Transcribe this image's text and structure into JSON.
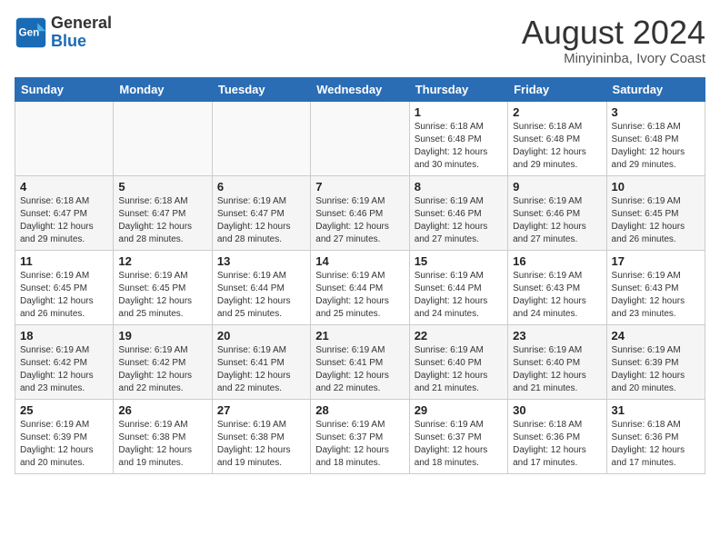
{
  "header": {
    "logo_line1": "General",
    "logo_line2": "Blue",
    "month_year": "August 2024",
    "location": "Minyininba, Ivory Coast"
  },
  "days_of_week": [
    "Sunday",
    "Monday",
    "Tuesday",
    "Wednesday",
    "Thursday",
    "Friday",
    "Saturday"
  ],
  "weeks": [
    [
      {
        "day": "",
        "info": ""
      },
      {
        "day": "",
        "info": ""
      },
      {
        "day": "",
        "info": ""
      },
      {
        "day": "",
        "info": ""
      },
      {
        "day": "1",
        "info": "Sunrise: 6:18 AM\nSunset: 6:48 PM\nDaylight: 12 hours\nand 30 minutes."
      },
      {
        "day": "2",
        "info": "Sunrise: 6:18 AM\nSunset: 6:48 PM\nDaylight: 12 hours\nand 29 minutes."
      },
      {
        "day": "3",
        "info": "Sunrise: 6:18 AM\nSunset: 6:48 PM\nDaylight: 12 hours\nand 29 minutes."
      }
    ],
    [
      {
        "day": "4",
        "info": "Sunrise: 6:18 AM\nSunset: 6:47 PM\nDaylight: 12 hours\nand 29 minutes."
      },
      {
        "day": "5",
        "info": "Sunrise: 6:18 AM\nSunset: 6:47 PM\nDaylight: 12 hours\nand 28 minutes."
      },
      {
        "day": "6",
        "info": "Sunrise: 6:19 AM\nSunset: 6:47 PM\nDaylight: 12 hours\nand 28 minutes."
      },
      {
        "day": "7",
        "info": "Sunrise: 6:19 AM\nSunset: 6:46 PM\nDaylight: 12 hours\nand 27 minutes."
      },
      {
        "day": "8",
        "info": "Sunrise: 6:19 AM\nSunset: 6:46 PM\nDaylight: 12 hours\nand 27 minutes."
      },
      {
        "day": "9",
        "info": "Sunrise: 6:19 AM\nSunset: 6:46 PM\nDaylight: 12 hours\nand 27 minutes."
      },
      {
        "day": "10",
        "info": "Sunrise: 6:19 AM\nSunset: 6:45 PM\nDaylight: 12 hours\nand 26 minutes."
      }
    ],
    [
      {
        "day": "11",
        "info": "Sunrise: 6:19 AM\nSunset: 6:45 PM\nDaylight: 12 hours\nand 26 minutes."
      },
      {
        "day": "12",
        "info": "Sunrise: 6:19 AM\nSunset: 6:45 PM\nDaylight: 12 hours\nand 25 minutes."
      },
      {
        "day": "13",
        "info": "Sunrise: 6:19 AM\nSunset: 6:44 PM\nDaylight: 12 hours\nand 25 minutes."
      },
      {
        "day": "14",
        "info": "Sunrise: 6:19 AM\nSunset: 6:44 PM\nDaylight: 12 hours\nand 25 minutes."
      },
      {
        "day": "15",
        "info": "Sunrise: 6:19 AM\nSunset: 6:44 PM\nDaylight: 12 hours\nand 24 minutes."
      },
      {
        "day": "16",
        "info": "Sunrise: 6:19 AM\nSunset: 6:43 PM\nDaylight: 12 hours\nand 24 minutes."
      },
      {
        "day": "17",
        "info": "Sunrise: 6:19 AM\nSunset: 6:43 PM\nDaylight: 12 hours\nand 23 minutes."
      }
    ],
    [
      {
        "day": "18",
        "info": "Sunrise: 6:19 AM\nSunset: 6:42 PM\nDaylight: 12 hours\nand 23 minutes."
      },
      {
        "day": "19",
        "info": "Sunrise: 6:19 AM\nSunset: 6:42 PM\nDaylight: 12 hours\nand 22 minutes."
      },
      {
        "day": "20",
        "info": "Sunrise: 6:19 AM\nSunset: 6:41 PM\nDaylight: 12 hours\nand 22 minutes."
      },
      {
        "day": "21",
        "info": "Sunrise: 6:19 AM\nSunset: 6:41 PM\nDaylight: 12 hours\nand 22 minutes."
      },
      {
        "day": "22",
        "info": "Sunrise: 6:19 AM\nSunset: 6:40 PM\nDaylight: 12 hours\nand 21 minutes."
      },
      {
        "day": "23",
        "info": "Sunrise: 6:19 AM\nSunset: 6:40 PM\nDaylight: 12 hours\nand 21 minutes."
      },
      {
        "day": "24",
        "info": "Sunrise: 6:19 AM\nSunset: 6:39 PM\nDaylight: 12 hours\nand 20 minutes."
      }
    ],
    [
      {
        "day": "25",
        "info": "Sunrise: 6:19 AM\nSunset: 6:39 PM\nDaylight: 12 hours\nand 20 minutes."
      },
      {
        "day": "26",
        "info": "Sunrise: 6:19 AM\nSunset: 6:38 PM\nDaylight: 12 hours\nand 19 minutes."
      },
      {
        "day": "27",
        "info": "Sunrise: 6:19 AM\nSunset: 6:38 PM\nDaylight: 12 hours\nand 19 minutes."
      },
      {
        "day": "28",
        "info": "Sunrise: 6:19 AM\nSunset: 6:37 PM\nDaylight: 12 hours\nand 18 minutes."
      },
      {
        "day": "29",
        "info": "Sunrise: 6:19 AM\nSunset: 6:37 PM\nDaylight: 12 hours\nand 18 minutes."
      },
      {
        "day": "30",
        "info": "Sunrise: 6:18 AM\nSunset: 6:36 PM\nDaylight: 12 hours\nand 17 minutes."
      },
      {
        "day": "31",
        "info": "Sunrise: 6:18 AM\nSunset: 6:36 PM\nDaylight: 12 hours\nand 17 minutes."
      }
    ]
  ]
}
